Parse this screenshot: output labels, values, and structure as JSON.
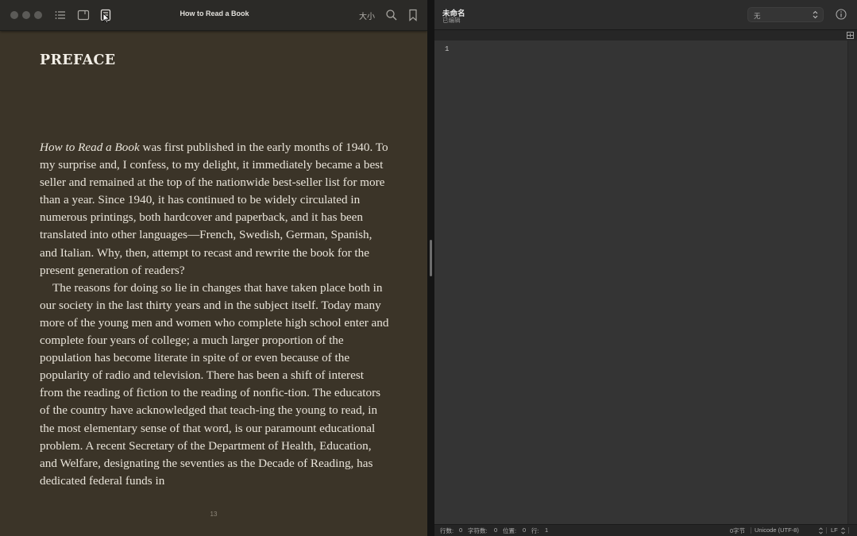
{
  "books": {
    "window_title": "How to Read a Book",
    "toolbar": {
      "size_label": "大小",
      "icons": [
        "table-of-contents-icon",
        "notes-icon",
        "page-view-icon",
        "search-icon",
        "bookmark-icon"
      ]
    },
    "chapter_heading": "PREFACE",
    "paragraphs": [
      {
        "title_italic": "How to Read a Book",
        "text": " was first published in the early months of 1940. To my surprise and, I confess, to my delight, it immediately became a best seller and remained at the top of the nationwide best-seller list for more than a year. Since 1940, it has continued to be widely circulated in numerous printings, both hardcover and paperback, and it has been translated into other languages—French, Swedish, German, Spanish, and Italian. Why, then, attempt to recast and rewrite the book for the present generation of readers?"
      },
      {
        "text": "The reasons for doing so lie in changes that have taken place both in our society in the last thirty years and in the subject itself. Today many more of the young men and women who complete high school enter and complete four years of college; a much larger proportion of the population has become literate in spite of or even because of the popularity of radio and television. There has been a shift of interest from the reading of fiction to the reading of nonfic-tion. The educators of the country have acknowledged that teach-ing the young to read, in the most elementary sense of that word, is our paramount educational problem. A recent Secretary of the Department of Health, Education, and Welfare, designating the seventies as the Decade of Reading, has dedicated federal funds in"
      }
    ],
    "page_number": "13"
  },
  "editor": {
    "document_name": "未命名",
    "document_status": "已编辑",
    "syntax_mode": "无",
    "gutter_line": "1",
    "status_bar": {
      "lines_label": "行数:",
      "lines_value": "0",
      "chars_label": "字符数:",
      "chars_value": "0",
      "location_label": "位置:",
      "location_value": "0",
      "line_label": "行:",
      "line_value": "1",
      "bytes": "0字节",
      "encoding": "Unicode (UTF-8)",
      "line_ending": "LF"
    }
  },
  "colors": {
    "book_page_bg": "#3b3428",
    "book_text": "#e9e4da",
    "toolbar_bg": "#2b2a27",
    "editor_bg": "#343434"
  }
}
